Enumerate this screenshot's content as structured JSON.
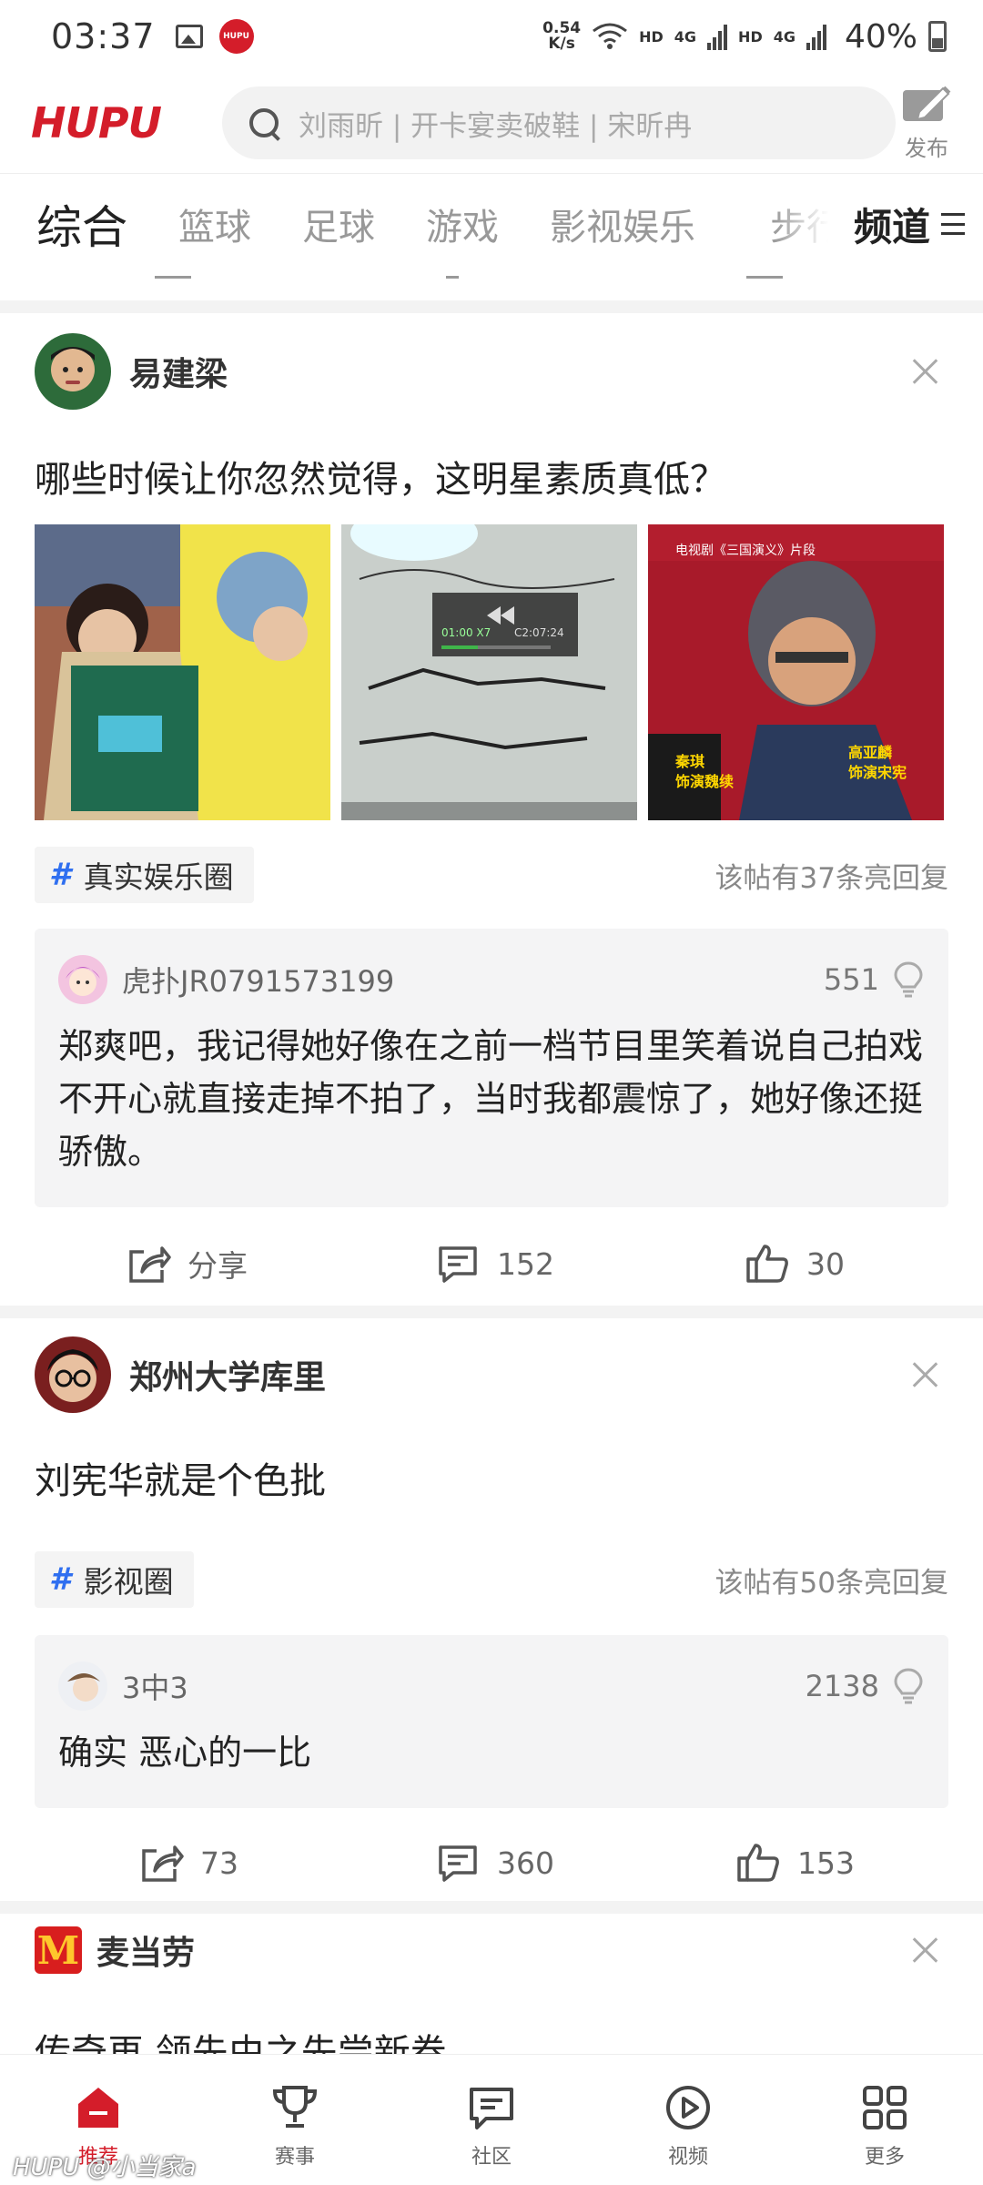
{
  "status_bar": {
    "time": "03:37",
    "net_speed_value": "0.54",
    "net_speed_unit": "K/s",
    "hd1": "HD",
    "sig1": "4G",
    "hd2": "HD",
    "sig2": "4G",
    "battery": "40%"
  },
  "header": {
    "logo": "HUPU",
    "search_placeholder": "刘雨昕 | 开卡宴卖破鞋 | 宋昕冉",
    "publish_label": "发布"
  },
  "tabs": {
    "items": [
      "综合",
      "篮球",
      "足球",
      "游戏",
      "影视娱乐"
    ],
    "overflow": "步行",
    "channel_label": "频道"
  },
  "posts": [
    {
      "author": "易建梁",
      "title": "哪些时候让你忽然觉得，这明星素质真低？",
      "thumb2_timestamp": "C2:07:24",
      "thumb2_speed": "01:00 X7",
      "thumb3_caption_left": "秦琪\n饰演魏续",
      "thumb3_caption_right": "高亚麟\n饰演宋宪",
      "thumb3_top_text": "电视剧《三国演义》片段",
      "tag": "真实娱乐圈",
      "reply_count": "该帖有37条亮回复",
      "reply": {
        "user": "虎扑JR0791573199",
        "likes": "551",
        "text": "郑爽吧，我记得她好像在之前一档节目里笑着说自己拍戏不开心就直接走掉不拍了，当时我都震惊了，她好像还挺骄傲。"
      },
      "actions": {
        "share": "分享",
        "comments": "152",
        "likes": "30"
      }
    },
    {
      "author": "郑州大学库里",
      "title": "刘宪华就是个色批",
      "tag": "影视圈",
      "reply_count": "该帖有50条亮回复",
      "reply": {
        "user": "3中3",
        "likes": "2138",
        "text": "确实 恶心的一比"
      },
      "actions": {
        "share": "73",
        "comments": "360",
        "likes": "153"
      }
    }
  ],
  "ad": {
    "advertiser": "麦当劳",
    "logo_letter": "M",
    "title": "传奇再 领先由之先尝新卷"
  },
  "bottom_nav": [
    {
      "label": "推荐",
      "icon": "home-icon"
    },
    {
      "label": "赛事",
      "icon": "trophy-icon"
    },
    {
      "label": "社区",
      "icon": "chat-icon"
    },
    {
      "label": "视频",
      "icon": "play-icon"
    },
    {
      "label": "更多",
      "icon": "grid-icon"
    }
  ],
  "watermark": "HUPU @小当家a",
  "colors": {
    "brand": "#d41d2a",
    "tag_hash": "#2f6ff0",
    "mcd_red": "#d81e1e",
    "mcd_yellow": "#ffc72c"
  }
}
